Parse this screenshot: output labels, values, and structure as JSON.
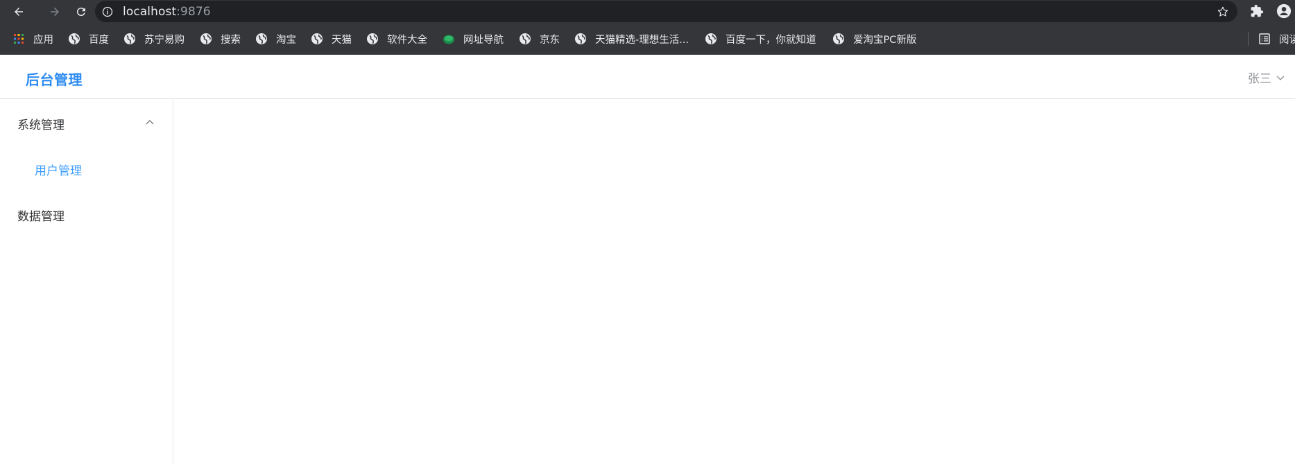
{
  "browser": {
    "url_host": "localhost",
    "url_port": ":9876",
    "bookmarks": [
      {
        "label": "应用",
        "icon": "apps-grid-icon"
      },
      {
        "label": "百度",
        "icon": "globe-icon"
      },
      {
        "label": "苏宁易购",
        "icon": "globe-icon"
      },
      {
        "label": "搜索",
        "icon": "globe-icon"
      },
      {
        "label": "淘宝",
        "icon": "globe-icon"
      },
      {
        "label": "天猫",
        "icon": "globe-icon"
      },
      {
        "label": "软件大全",
        "icon": "globe-icon"
      },
      {
        "label": "网址导航",
        "icon": "green-leaf-icon"
      },
      {
        "label": "京东",
        "icon": "globe-icon"
      },
      {
        "label": "天猫精选-理想生活...",
        "icon": "globe-icon"
      },
      {
        "label": "百度一下，你就知道",
        "icon": "globe-icon"
      },
      {
        "label": "爱淘宝PC新版",
        "icon": "globe-icon"
      },
      {
        "label": "阅读",
        "icon": "reading-list-icon"
      }
    ]
  },
  "app": {
    "title": "后台管理",
    "user": "张三",
    "menu": {
      "system": "系统管理",
      "user_mgmt": "用户管理",
      "data": "数据管理"
    }
  },
  "colors": {
    "chrome_bg": "#35363a",
    "omnibox_bg": "#202124",
    "brand_blue": "#2d8cf0",
    "active_submenu": "#409eff"
  }
}
